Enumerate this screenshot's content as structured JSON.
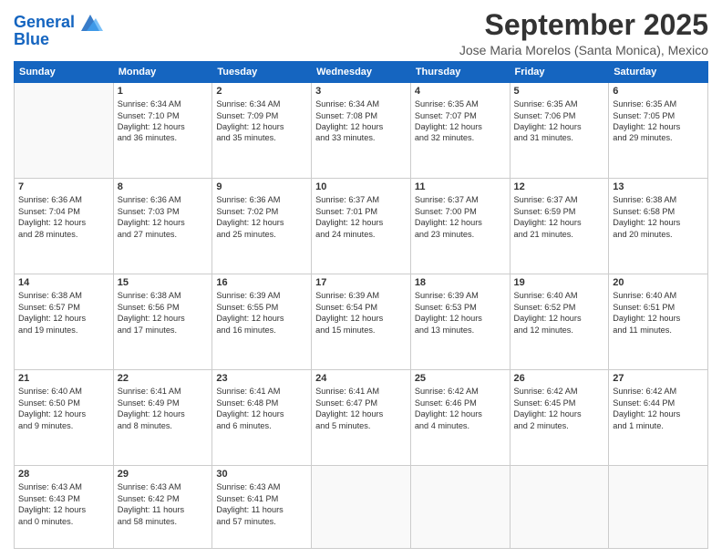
{
  "header": {
    "logo_line1": "General",
    "logo_line2": "Blue",
    "month": "September 2025",
    "location": "Jose Maria Morelos (Santa Monica), Mexico"
  },
  "days_of_week": [
    "Sunday",
    "Monday",
    "Tuesday",
    "Wednesday",
    "Thursday",
    "Friday",
    "Saturday"
  ],
  "weeks": [
    [
      {
        "day": "",
        "text": ""
      },
      {
        "day": "1",
        "text": "Sunrise: 6:34 AM\nSunset: 7:10 PM\nDaylight: 12 hours\nand 36 minutes."
      },
      {
        "day": "2",
        "text": "Sunrise: 6:34 AM\nSunset: 7:09 PM\nDaylight: 12 hours\nand 35 minutes."
      },
      {
        "day": "3",
        "text": "Sunrise: 6:34 AM\nSunset: 7:08 PM\nDaylight: 12 hours\nand 33 minutes."
      },
      {
        "day": "4",
        "text": "Sunrise: 6:35 AM\nSunset: 7:07 PM\nDaylight: 12 hours\nand 32 minutes."
      },
      {
        "day": "5",
        "text": "Sunrise: 6:35 AM\nSunset: 7:06 PM\nDaylight: 12 hours\nand 31 minutes."
      },
      {
        "day": "6",
        "text": "Sunrise: 6:35 AM\nSunset: 7:05 PM\nDaylight: 12 hours\nand 29 minutes."
      }
    ],
    [
      {
        "day": "7",
        "text": "Sunrise: 6:36 AM\nSunset: 7:04 PM\nDaylight: 12 hours\nand 28 minutes."
      },
      {
        "day": "8",
        "text": "Sunrise: 6:36 AM\nSunset: 7:03 PM\nDaylight: 12 hours\nand 27 minutes."
      },
      {
        "day": "9",
        "text": "Sunrise: 6:36 AM\nSunset: 7:02 PM\nDaylight: 12 hours\nand 25 minutes."
      },
      {
        "day": "10",
        "text": "Sunrise: 6:37 AM\nSunset: 7:01 PM\nDaylight: 12 hours\nand 24 minutes."
      },
      {
        "day": "11",
        "text": "Sunrise: 6:37 AM\nSunset: 7:00 PM\nDaylight: 12 hours\nand 23 minutes."
      },
      {
        "day": "12",
        "text": "Sunrise: 6:37 AM\nSunset: 6:59 PM\nDaylight: 12 hours\nand 21 minutes."
      },
      {
        "day": "13",
        "text": "Sunrise: 6:38 AM\nSunset: 6:58 PM\nDaylight: 12 hours\nand 20 minutes."
      }
    ],
    [
      {
        "day": "14",
        "text": "Sunrise: 6:38 AM\nSunset: 6:57 PM\nDaylight: 12 hours\nand 19 minutes."
      },
      {
        "day": "15",
        "text": "Sunrise: 6:38 AM\nSunset: 6:56 PM\nDaylight: 12 hours\nand 17 minutes."
      },
      {
        "day": "16",
        "text": "Sunrise: 6:39 AM\nSunset: 6:55 PM\nDaylight: 12 hours\nand 16 minutes."
      },
      {
        "day": "17",
        "text": "Sunrise: 6:39 AM\nSunset: 6:54 PM\nDaylight: 12 hours\nand 15 minutes."
      },
      {
        "day": "18",
        "text": "Sunrise: 6:39 AM\nSunset: 6:53 PM\nDaylight: 12 hours\nand 13 minutes."
      },
      {
        "day": "19",
        "text": "Sunrise: 6:40 AM\nSunset: 6:52 PM\nDaylight: 12 hours\nand 12 minutes."
      },
      {
        "day": "20",
        "text": "Sunrise: 6:40 AM\nSunset: 6:51 PM\nDaylight: 12 hours\nand 11 minutes."
      }
    ],
    [
      {
        "day": "21",
        "text": "Sunrise: 6:40 AM\nSunset: 6:50 PM\nDaylight: 12 hours\nand 9 minutes."
      },
      {
        "day": "22",
        "text": "Sunrise: 6:41 AM\nSunset: 6:49 PM\nDaylight: 12 hours\nand 8 minutes."
      },
      {
        "day": "23",
        "text": "Sunrise: 6:41 AM\nSunset: 6:48 PM\nDaylight: 12 hours\nand 6 minutes."
      },
      {
        "day": "24",
        "text": "Sunrise: 6:41 AM\nSunset: 6:47 PM\nDaylight: 12 hours\nand 5 minutes."
      },
      {
        "day": "25",
        "text": "Sunrise: 6:42 AM\nSunset: 6:46 PM\nDaylight: 12 hours\nand 4 minutes."
      },
      {
        "day": "26",
        "text": "Sunrise: 6:42 AM\nSunset: 6:45 PM\nDaylight: 12 hours\nand 2 minutes."
      },
      {
        "day": "27",
        "text": "Sunrise: 6:42 AM\nSunset: 6:44 PM\nDaylight: 12 hours\nand 1 minute."
      }
    ],
    [
      {
        "day": "28",
        "text": "Sunrise: 6:43 AM\nSunset: 6:43 PM\nDaylight: 12 hours\nand 0 minutes."
      },
      {
        "day": "29",
        "text": "Sunrise: 6:43 AM\nSunset: 6:42 PM\nDaylight: 11 hours\nand 58 minutes."
      },
      {
        "day": "30",
        "text": "Sunrise: 6:43 AM\nSunset: 6:41 PM\nDaylight: 11 hours\nand 57 minutes."
      },
      {
        "day": "",
        "text": ""
      },
      {
        "day": "",
        "text": ""
      },
      {
        "day": "",
        "text": ""
      },
      {
        "day": "",
        "text": ""
      }
    ]
  ]
}
